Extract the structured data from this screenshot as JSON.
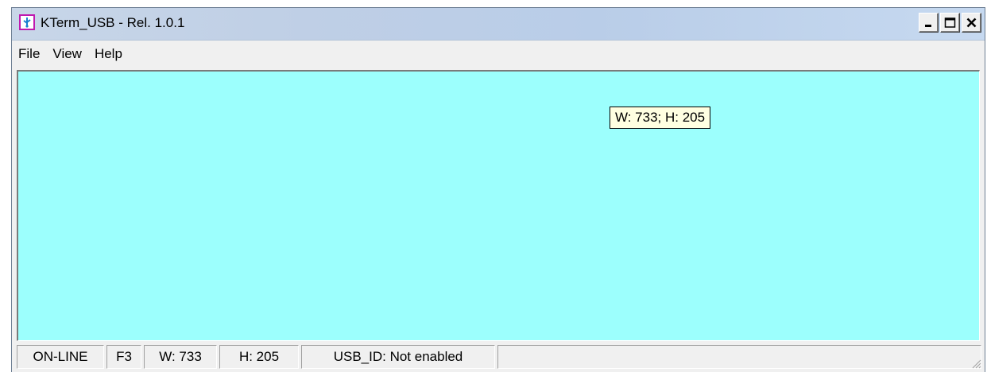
{
  "window": {
    "title": "KTerm_USB - Rel. 1.0.1",
    "app_icon": "usb-icon",
    "controls": [
      "minimize-icon",
      "maximize-icon",
      "close-icon"
    ]
  },
  "menu": {
    "items": [
      {
        "label": "File"
      },
      {
        "label": "View"
      },
      {
        "label": "Help"
      }
    ]
  },
  "terminal": {
    "background_color": "#9cfffd",
    "size_tooltip": "W:  733; H:  205"
  },
  "status": {
    "connection": "ON-LINE",
    "function_key": "F3",
    "width": "W:  733",
    "height": "H:  205",
    "usb_id": "USB_ID: Not enabled",
    "extra": ""
  }
}
